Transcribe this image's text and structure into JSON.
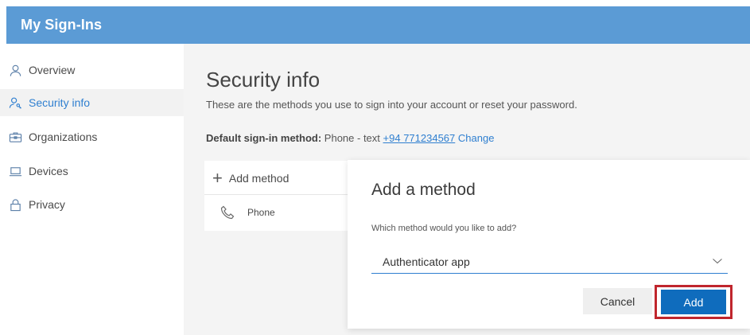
{
  "app": {
    "title": "My Sign-Ins"
  },
  "sidebar": {
    "items": [
      {
        "label": "Overview",
        "icon": "person-icon",
        "active": false
      },
      {
        "label": "Security info",
        "icon": "person-key-icon",
        "active": true
      },
      {
        "label": "Organizations",
        "icon": "briefcase-icon",
        "active": false
      },
      {
        "label": "Devices",
        "icon": "laptop-icon",
        "active": false
      },
      {
        "label": "Privacy",
        "icon": "lock-icon",
        "active": false
      }
    ]
  },
  "main": {
    "title": "Security info",
    "description": "These are the methods you use to sign into your account or reset your password.",
    "default_method": {
      "label": "Default sign-in method:",
      "value": "Phone - text",
      "phone": "+94 771234567",
      "change_link": "Change"
    },
    "add_method_label": "Add method",
    "methods": [
      {
        "name": "Phone",
        "icon": "phone-icon"
      }
    ]
  },
  "dialog": {
    "title": "Add a method",
    "question": "Which method would you like to add?",
    "selected_method": "Authenticator app",
    "cancel_label": "Cancel",
    "add_label": "Add"
  },
  "colors": {
    "topbar": "#5b9bd5",
    "accent": "#2f7fd0",
    "primary_button": "#0f6cbd",
    "highlight_border": "#c0262d"
  }
}
